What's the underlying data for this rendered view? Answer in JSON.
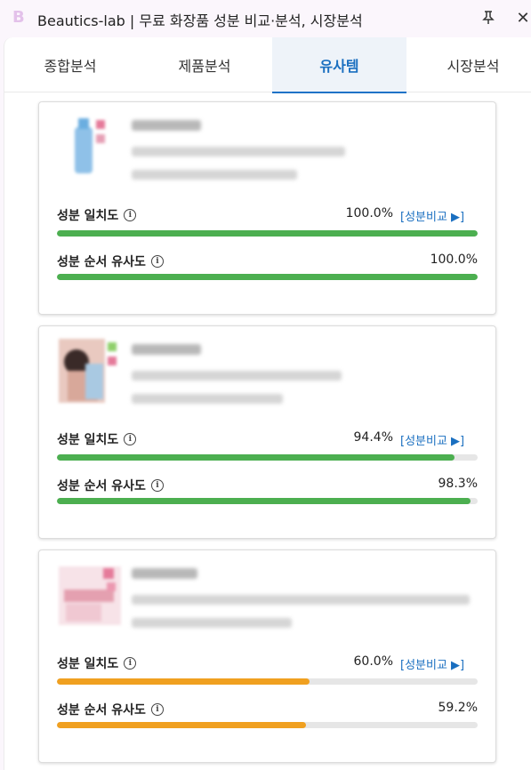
{
  "window": {
    "logo": "B",
    "title": "Beautics-lab | 무료 화장품 성분 비교·분석, 시장분석",
    "pin_icon": "pin-icon",
    "close_icon": "close-icon"
  },
  "tabs": [
    {
      "label": "종합분석",
      "active": false
    },
    {
      "label": "제품분석",
      "active": false
    },
    {
      "label": "유사템",
      "active": true
    },
    {
      "label": "시장분석",
      "active": false
    }
  ],
  "colors": {
    "high": "#4caf50",
    "mid": "#f0a020",
    "accent": "#1a6fc0"
  },
  "labels": {
    "ingredient_match": "성분 일치도",
    "order_similarity": "성분 순서 유사도",
    "compare_link": "[성분비교 ▶]"
  },
  "items": [
    {
      "ingredient_match": "100.0%",
      "ingredient_match_pct": 100,
      "order_similarity": "100.0%",
      "order_similarity_pct": 100,
      "level": "high"
    },
    {
      "ingredient_match": "94.4%",
      "ingredient_match_pct": 94.4,
      "order_similarity": "98.3%",
      "order_similarity_pct": 98.3,
      "level": "high"
    },
    {
      "ingredient_match": "60.0%",
      "ingredient_match_pct": 60.0,
      "order_similarity": "59.2%",
      "order_similarity_pct": 59.2,
      "level": "mid"
    }
  ]
}
